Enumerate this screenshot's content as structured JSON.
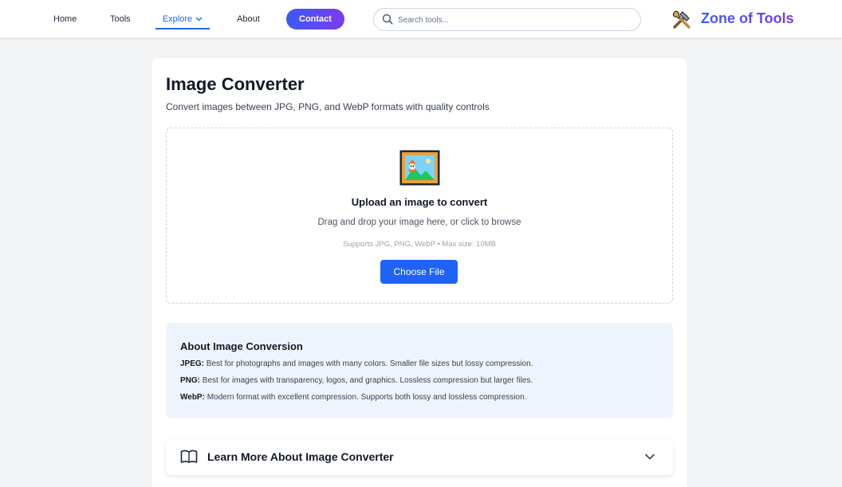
{
  "nav": {
    "home": "Home",
    "tools": "Tools",
    "explore": "Explore",
    "about": "About",
    "contact": "Contact"
  },
  "search": {
    "placeholder": "Search tools..."
  },
  "brand": {
    "name": "Zone of Tools",
    "icon": "hammer-wrench-icon"
  },
  "page": {
    "title": "Image Converter",
    "subtitle": "Convert images between JPG, PNG, and WebP formats with quality controls"
  },
  "upload": {
    "icon": "framed-picture-icon",
    "title": "Upload an image to convert",
    "hint": "Drag and drop your image here, or click to browse",
    "supports": "Supports JPG, PNG, WebP • Max size: 10MB",
    "button": "Choose File"
  },
  "about": {
    "title": "About Image Conversion",
    "items": [
      {
        "label": "JPEG:",
        "text": " Best for photographs and images with many colors. Smaller file sizes but lossy compression."
      },
      {
        "label": "PNG:",
        "text": " Best for images with transparency, logos, and graphics. Lossless compression but larger files."
      },
      {
        "label": "WebP:",
        "text": " Modern format with excellent compression. Supports both lossy and lossless compression."
      }
    ]
  },
  "learn_more": {
    "title": "Learn More About Image Converter",
    "icon": "book-icon"
  },
  "colors": {
    "accent": "#2563eb",
    "button": "#1e63f5",
    "gradient_start": "#3b5bf6",
    "gradient_end": "#7c3aed",
    "info_bg": "#eef4fe"
  }
}
